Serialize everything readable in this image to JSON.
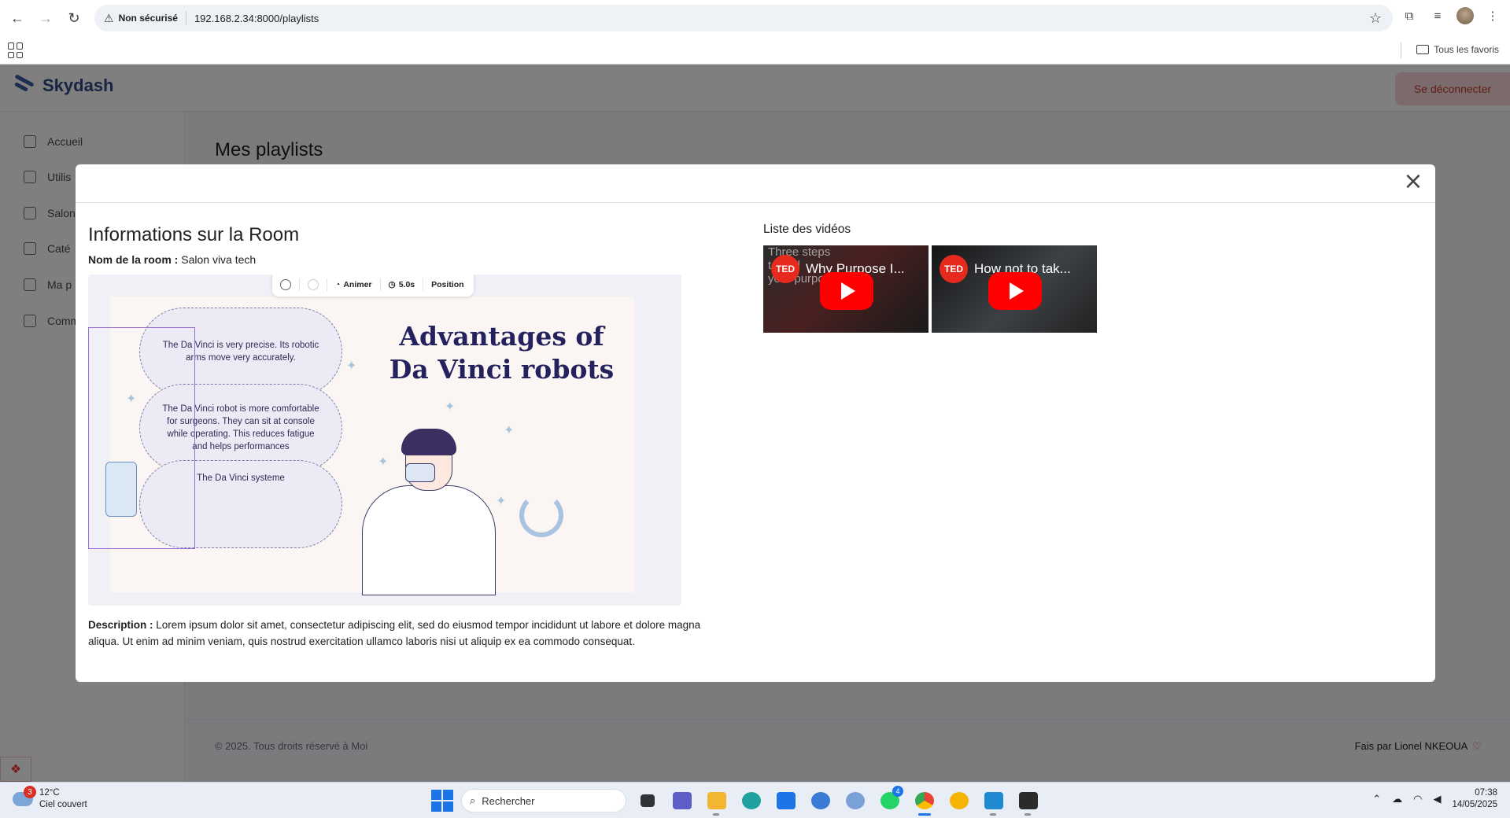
{
  "browser": {
    "security_label": "Non sécurisé",
    "url": "192.168.2.34:8000/playlists",
    "bookmarks_folder": "Tous les favoris"
  },
  "app": {
    "brand": "Skydash",
    "logout_label": "Se déconnecter",
    "page_title": "Mes playlists",
    "sidebar": [
      {
        "label": "Accueil",
        "icon": "grid-icon"
      },
      {
        "label": "Utilis",
        "icon": "layout-icon"
      },
      {
        "label": "Salon",
        "icon": "document-icon"
      },
      {
        "label": "Caté",
        "icon": "shrink-icon"
      },
      {
        "label": "Ma p",
        "icon": "map-icon"
      },
      {
        "label": "Comm",
        "icon": "chart-icon"
      }
    ],
    "footer_left": "© 2025. Tous droits réservé à Moi",
    "footer_right": "Fais par Lionel NKEOUA"
  },
  "modal": {
    "title": "Informations sur la Room",
    "room_name_label": "Nom de la room :",
    "room_name_value": "Salon viva tech",
    "description_label": "Description :",
    "description_value": "Lorem ipsum dolor sit amet, consectetur adipiscing elit, sed do eiusmod tempor incididunt ut labore et dolore magna aliqua. Ut enim ad minim veniam, quis nostrud exercitation ullamco laboris nisi ut aliquip ex ea commodo consequat.",
    "videos_title": "Liste des vidéos",
    "toolbar": {
      "animate_label": "Animer",
      "duration_label": "5.0s",
      "position_label": "Position"
    },
    "slide": {
      "title": "Advantages of Da Vinci robots",
      "pill_1": "The Da Vinci is very precise. Its robotic arms move very accurately.",
      "pill_2": "The Da Vinci robot is more comfortable for surgeons. They can sit at console while operating. This reduces fatigue and helps performances",
      "pill_3": "The Da Vinci systeme"
    },
    "videos": [
      {
        "title": "Why Purpose I...",
        "overlay_text": "Three steps\nto find\nyour purpose",
        "badge": "TED"
      },
      {
        "title": "How not to tak...",
        "badge": "TED"
      }
    ]
  },
  "taskbar": {
    "temperature": "12°C",
    "weather": "Ciel couvert",
    "weather_badge": "3",
    "search_placeholder": "Rechercher",
    "whatsapp_badge": "4",
    "time": "07:38",
    "date": "14/05/2025"
  },
  "colors": {
    "accent": "#2e4a86",
    "logout_bg": "#f8d7da",
    "youtube_red": "#ff0000",
    "ted_red": "#e62b1e",
    "selection_purple": "#9b6cd1"
  }
}
